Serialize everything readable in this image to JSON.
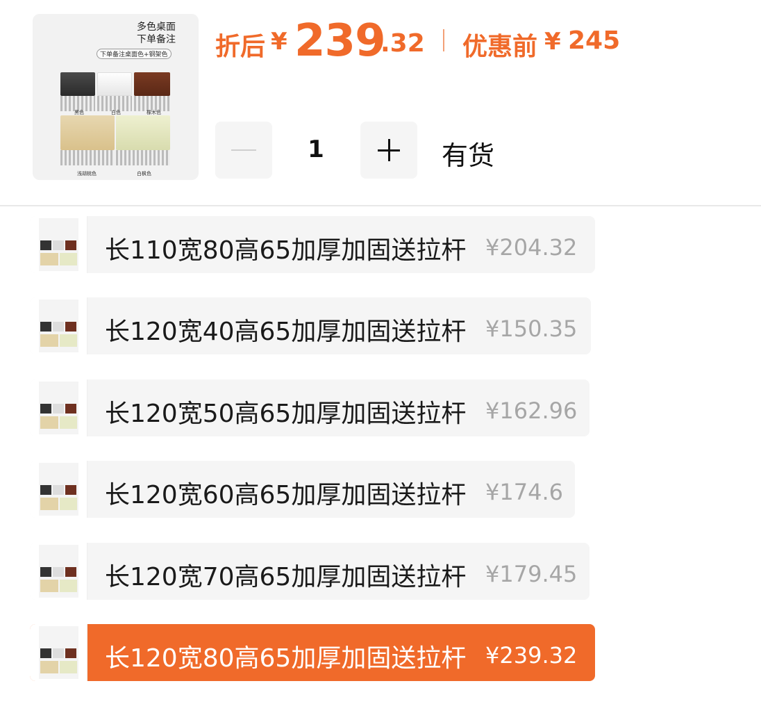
{
  "product": {
    "image_caption_line1": "多色桌面",
    "image_caption_line2": "下单备注",
    "image_badge": "下单备注桌面色+钢架色",
    "tile_labels": [
      "黑色",
      "白色",
      "橡木色",
      "浅胡桃色",
      "白枫色"
    ]
  },
  "price": {
    "after_label": "折后",
    "currency": "¥",
    "after_integer": "239",
    "after_decimal": ".32",
    "before_label": "优惠前",
    "before_value": "245",
    "accent_color": "#f06a2a"
  },
  "quantity": {
    "value": "1",
    "minus_icon": "minus-icon",
    "plus_icon": "plus-icon",
    "stock_status": "有货"
  },
  "variants": [
    {
      "name": "长110宽80高65加厚加固送拉杆",
      "price": "¥204.32",
      "selected": false
    },
    {
      "name": "长120宽40高65加厚加固送拉杆",
      "price": "¥150.35",
      "selected": false
    },
    {
      "name": "长120宽50高65加厚加固送拉杆",
      "price": "¥162.96",
      "selected": false
    },
    {
      "name": "长120宽60高65加厚加固送拉杆",
      "price": "¥174.6",
      "selected": false
    },
    {
      "name": "长120宽70高65加厚加固送拉杆",
      "price": "¥179.45",
      "selected": false
    },
    {
      "name": "长120宽80高65加厚加固送拉杆",
      "price": "¥239.32",
      "selected": true
    }
  ]
}
